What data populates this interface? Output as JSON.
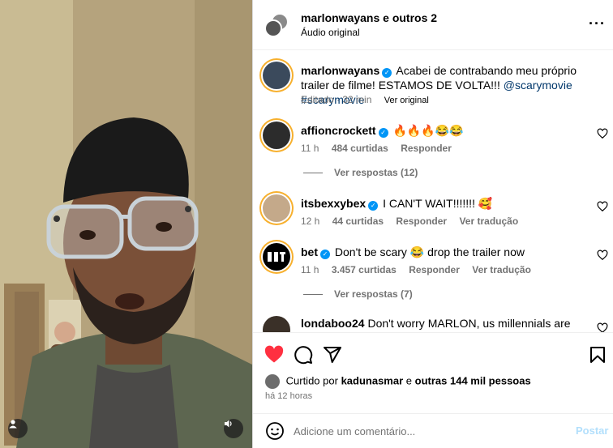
{
  "header": {
    "title": "marlonwayans e outros 2",
    "subtitle": "Áudio original",
    "more_icon": "more-horizontal-icon"
  },
  "caption": {
    "username": "marlonwayans",
    "text": "Acabei de contrabando meu próprio trailer de filme! ESTAMOS DE VOLTA!!!",
    "mention": "@scarymovie",
    "hashtag": "#scarymovie",
    "edited": "Editado · 32 min",
    "see_original": "Ver original"
  },
  "comments": [
    {
      "username": "affioncrockett",
      "text": "🔥🔥🔥😂😂",
      "time": "11 h",
      "likes": "484 curtidas",
      "reply": "Responder",
      "translate": "",
      "view_replies": "Ver respostas (12)"
    },
    {
      "username": "itsbexxybex",
      "text": "I CAN'T WAIT!!!!!!! 🥰",
      "time": "12 h",
      "likes": "44 curtidas",
      "reply": "Responder",
      "translate": "Ver tradução",
      "view_replies": ""
    },
    {
      "username": "bet",
      "text": "Don't be scary 😂 drop the trailer now",
      "time": "11 h",
      "likes": "3.457 curtidas",
      "reply": "Responder",
      "translate": "Ver tradução",
      "view_replies": "Ver respostas (7)"
    },
    {
      "username": "londaboo24",
      "text": "Don't worry MARLON, us millennials are coming"
    }
  ],
  "actions": {
    "liked_prefix": "Curtido por",
    "liked_user": "kadunasmar",
    "liked_mid": "e",
    "liked_others": "outras 144 mil pessoas",
    "time_ago": "há 12 horas"
  },
  "add_comment": {
    "placeholder": "Adicione um comentário...",
    "post_label": "Postar"
  },
  "colors": {
    "like_red": "#ff3040",
    "verified_blue": "#0095f6",
    "link_blue": "#00376b",
    "post_disabled": "#b2dffc"
  }
}
